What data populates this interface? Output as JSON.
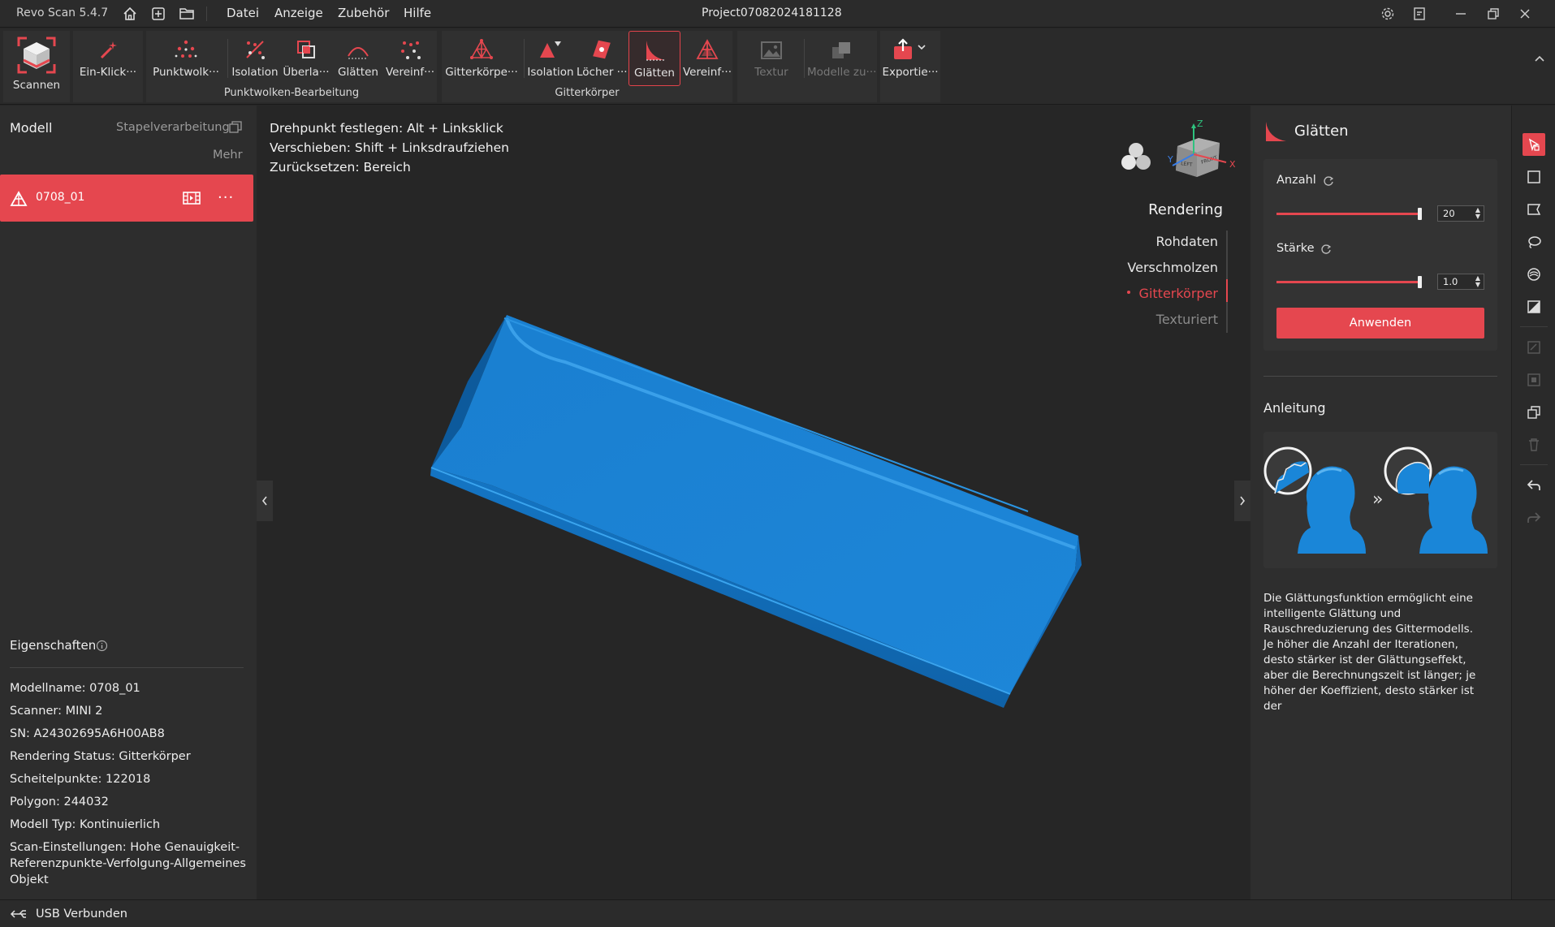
{
  "titlebar": {
    "app_name": "Revo Scan 5.4.7",
    "menu": [
      "Datei",
      "Anzeige",
      "Zubehör",
      "Hilfe"
    ],
    "project": "Project07082024181128"
  },
  "toolbar": {
    "scan_label": "Scannen",
    "oneclick_label": "Ein-Klick···",
    "pointcloud_group": {
      "label": "Punktwolken-Bearbeitung",
      "buttons": [
        "Punktwolk···",
        "Isolation",
        "Überla···",
        "Glätten",
        "Vereinf···"
      ]
    },
    "mesh_group": {
      "label": "Gitterkörper",
      "buttons": [
        "Gitterkörpe···",
        "Isolation",
        "Löcher ···",
        "Glätten",
        "Vereinf···"
      ]
    },
    "texture_label": "Textur",
    "merge_label": "Modelle zu···",
    "export_label": "Exportie···"
  },
  "left_panel": {
    "title": "Modell",
    "batch": "Stapelverarbeitung",
    "more": "Mehr",
    "model_name": "0708_01",
    "properties": {
      "heading": "Eigenschaften",
      "rows": [
        "Modellname:  0708_01",
        "Scanner:  MINI 2",
        "SN:  A24302695A6H00AB8",
        "Rendering Status:  Gitterkörper",
        "Scheitelpunkte:  122018",
        "Polygon:  244032",
        "Modell Typ:  Kontinuierlich",
        "Scan-Einstellungen:  Hohe Genauigkeit-Referenzpunkte-Verfolgung-Allgemeines Objekt"
      ]
    }
  },
  "viewport": {
    "hints": [
      "Drehpunkt festlegen: Alt + Linksklick",
      "Verschieben: Shift + Linksdraufziehen",
      "Zurücksetzen: Bereich"
    ],
    "rendering": {
      "title": "Rendering",
      "items": [
        "Rohdaten",
        "Verschmolzen",
        "Gitterkörper",
        "Texturiert"
      ],
      "active": "Gitterkörper"
    },
    "cube_labels": {
      "z": "Z",
      "x": "X",
      "y": "Y",
      "front": "FRONT",
      "left": "LEFT"
    },
    "model_color": "#1f86d6"
  },
  "right_panel": {
    "title": "Glätten",
    "count_label": "Anzahl",
    "count_value": "20",
    "count_level": 1.0,
    "strength_label": "Stärke",
    "strength_value": "1.0",
    "strength_level": 1.0,
    "apply_label": "Anwenden",
    "guide_title": "Anleitung",
    "guide_text": "Die Glättungsfunktion ermöglicht eine intelligente Glättung und Rauschreduzierung des Gittermodells. Je höher die Anzahl der Iterationen, desto stärker ist der Glättungseffekt, aber die Berechnungszeit ist länger; je höher der Koeffizient, desto stärker ist der"
  },
  "status": {
    "text": "USB Verbunden"
  },
  "colors": {
    "accent": "#e5474f",
    "bg": "#262626",
    "panel": "#2d2d2d",
    "model": "#1f86d6"
  }
}
